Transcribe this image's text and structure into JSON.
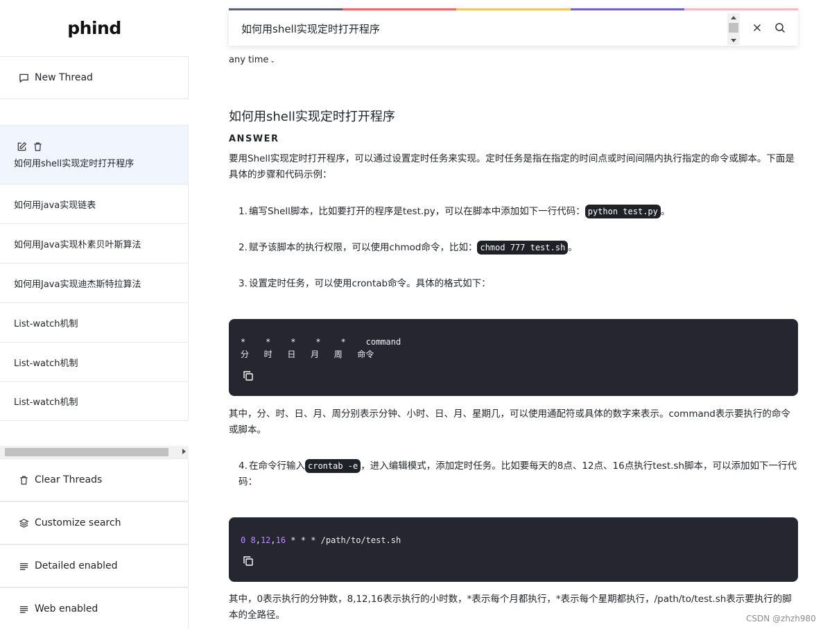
{
  "app": {
    "logo": "phind"
  },
  "sidebar": {
    "new_thread": "New Thread",
    "threads": [
      "如何用shell实现定时打开程序",
      "如何用java实现链表",
      "如何用Java实现朴素贝叶斯算法",
      "如何用Java实现迪杰斯特拉算法",
      "List-watch机制",
      "List-watch机制",
      "List-watch机制"
    ],
    "clear_threads": "Clear Threads",
    "customize_search": "Customize search",
    "detailed_enabled": "Detailed enabled",
    "web_enabled": "Web enabled"
  },
  "search": {
    "query": "如何用shell实现定时打开程序",
    "time_filter": "any time",
    "bar_colors": [
      "#5a5f73",
      "#e86a6a",
      "#f0c46e",
      "#6f5fcf",
      "#f4b9c1"
    ]
  },
  "answer": {
    "question": "如何用shell实现定时打开程序",
    "label": "ANSWER",
    "intro": "要用Shell实现定时打开程序，可以通过设置定时任务来实现。定时任务是指在指定的时间点或时间间隔内执行指定的命令或脚本。下面是具体的步骤和代码示例：",
    "step1_num": "1.",
    "step1_text": "编写Shell脚本，比如要打开的程序是test.py，可以在脚本中添加如下一行代码：",
    "step1_code": "python test.py",
    "step1_tail": "。",
    "step2_num": "2.",
    "step2_text": "赋予该脚本的执行权限，可以使用chmod命令，比如：",
    "step2_code": "chmod 777 test.sh",
    "step2_tail": "。",
    "step3_num": "3.",
    "step3_text": "设置定时任务，可以使用crontab命令。具体的格式如下：",
    "code1_line1": "*    *    *    *    *    command",
    "code1_line2": "分   时   日   月   周   命令",
    "explain1": "其中，分、时、日、月、周分别表示分钟、小时、日、月、星期几，可以使用通配符或具体的数字来表示。command表示要执行的命令或脚本。",
    "step4_num": "4.",
    "step4_text_a": "在命令行输入",
    "step4_code": "crontab -e",
    "step4_text_b": "，进入编辑模式，添加定时任务。比如要每天的8点、12点、16点执行test.sh脚本，可以添加如下一行代码：",
    "code2_tokens": {
      "n0": "0",
      "n8": "8",
      "c1": ",",
      "n12": "12",
      "c2": ",",
      "n16": "16",
      "rest": " * * * /path/to/test.sh"
    },
    "explain2": "其中，0表示执行的分钟数，8,12,16表示执行的小时数，*表示每个月都执行，*表示每个星期都执行，/path/to/test.sh表示要执行的脚本的全路径。"
  },
  "watermark": "CSDN @zhzh980"
}
